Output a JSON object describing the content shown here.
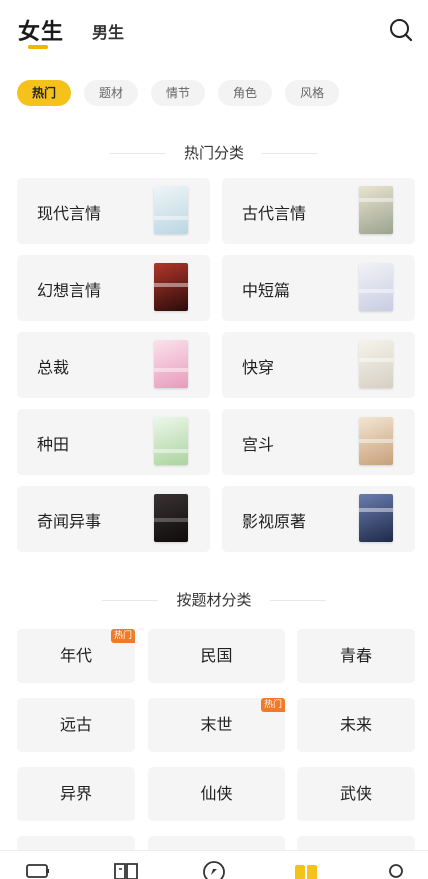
{
  "header": {
    "tabs": [
      {
        "label": "女生",
        "active": true
      },
      {
        "label": "男生",
        "active": false
      }
    ],
    "search_icon": "search-icon",
    "indicator_color": "#f5b400"
  },
  "filters": [
    {
      "label": "热门",
      "active": true
    },
    {
      "label": "题材",
      "active": false
    },
    {
      "label": "情节",
      "active": false
    },
    {
      "label": "角色",
      "active": false
    },
    {
      "label": "风格",
      "active": false
    }
  ],
  "hot_section": {
    "title": "热门分类",
    "items": [
      {
        "label": "现代言情",
        "cover_color": "#dbe8ee"
      },
      {
        "label": "古代言情",
        "cover_color": "#d8d2c0"
      },
      {
        "label": "幻想言情",
        "cover_color": "#8c2420"
      },
      {
        "label": "中短篇",
        "cover_color": "#e6e6ef"
      },
      {
        "label": "总裁",
        "cover_color": "#f2c8d8"
      },
      {
        "label": "快穿",
        "cover_color": "#ece8df"
      },
      {
        "label": "种田",
        "cover_color": "#d9ecd6"
      },
      {
        "label": "宫斗",
        "cover_color": "#e7d2b8"
      },
      {
        "label": "奇闻异事",
        "cover_color": "#2a2323"
      },
      {
        "label": "影视原著",
        "cover_color": "#3d4a6b"
      }
    ]
  },
  "theme_section": {
    "title": "按题材分类",
    "items": [
      {
        "label": "年代",
        "badge": "热门"
      },
      {
        "label": "民国",
        "badge": ""
      },
      {
        "label": "青春",
        "badge": ""
      },
      {
        "label": "远古",
        "badge": ""
      },
      {
        "label": "末世",
        "badge": "热门"
      },
      {
        "label": "未来",
        "badge": ""
      },
      {
        "label": "异界",
        "badge": ""
      },
      {
        "label": "仙侠",
        "badge": ""
      },
      {
        "label": "武侠",
        "badge": ""
      }
    ]
  },
  "bottom_nav": [
    {
      "icon": "bookshelf-icon",
      "active": false
    },
    {
      "icon": "book-open-icon",
      "active": false
    },
    {
      "icon": "compass-icon",
      "active": false
    },
    {
      "icon": "category-icon",
      "active": true
    },
    {
      "icon": "profile-icon",
      "active": false
    }
  ],
  "colors": {
    "accent": "#f5c21b",
    "badge": "#f07a2a",
    "card_bg": "#f5f5f5"
  }
}
